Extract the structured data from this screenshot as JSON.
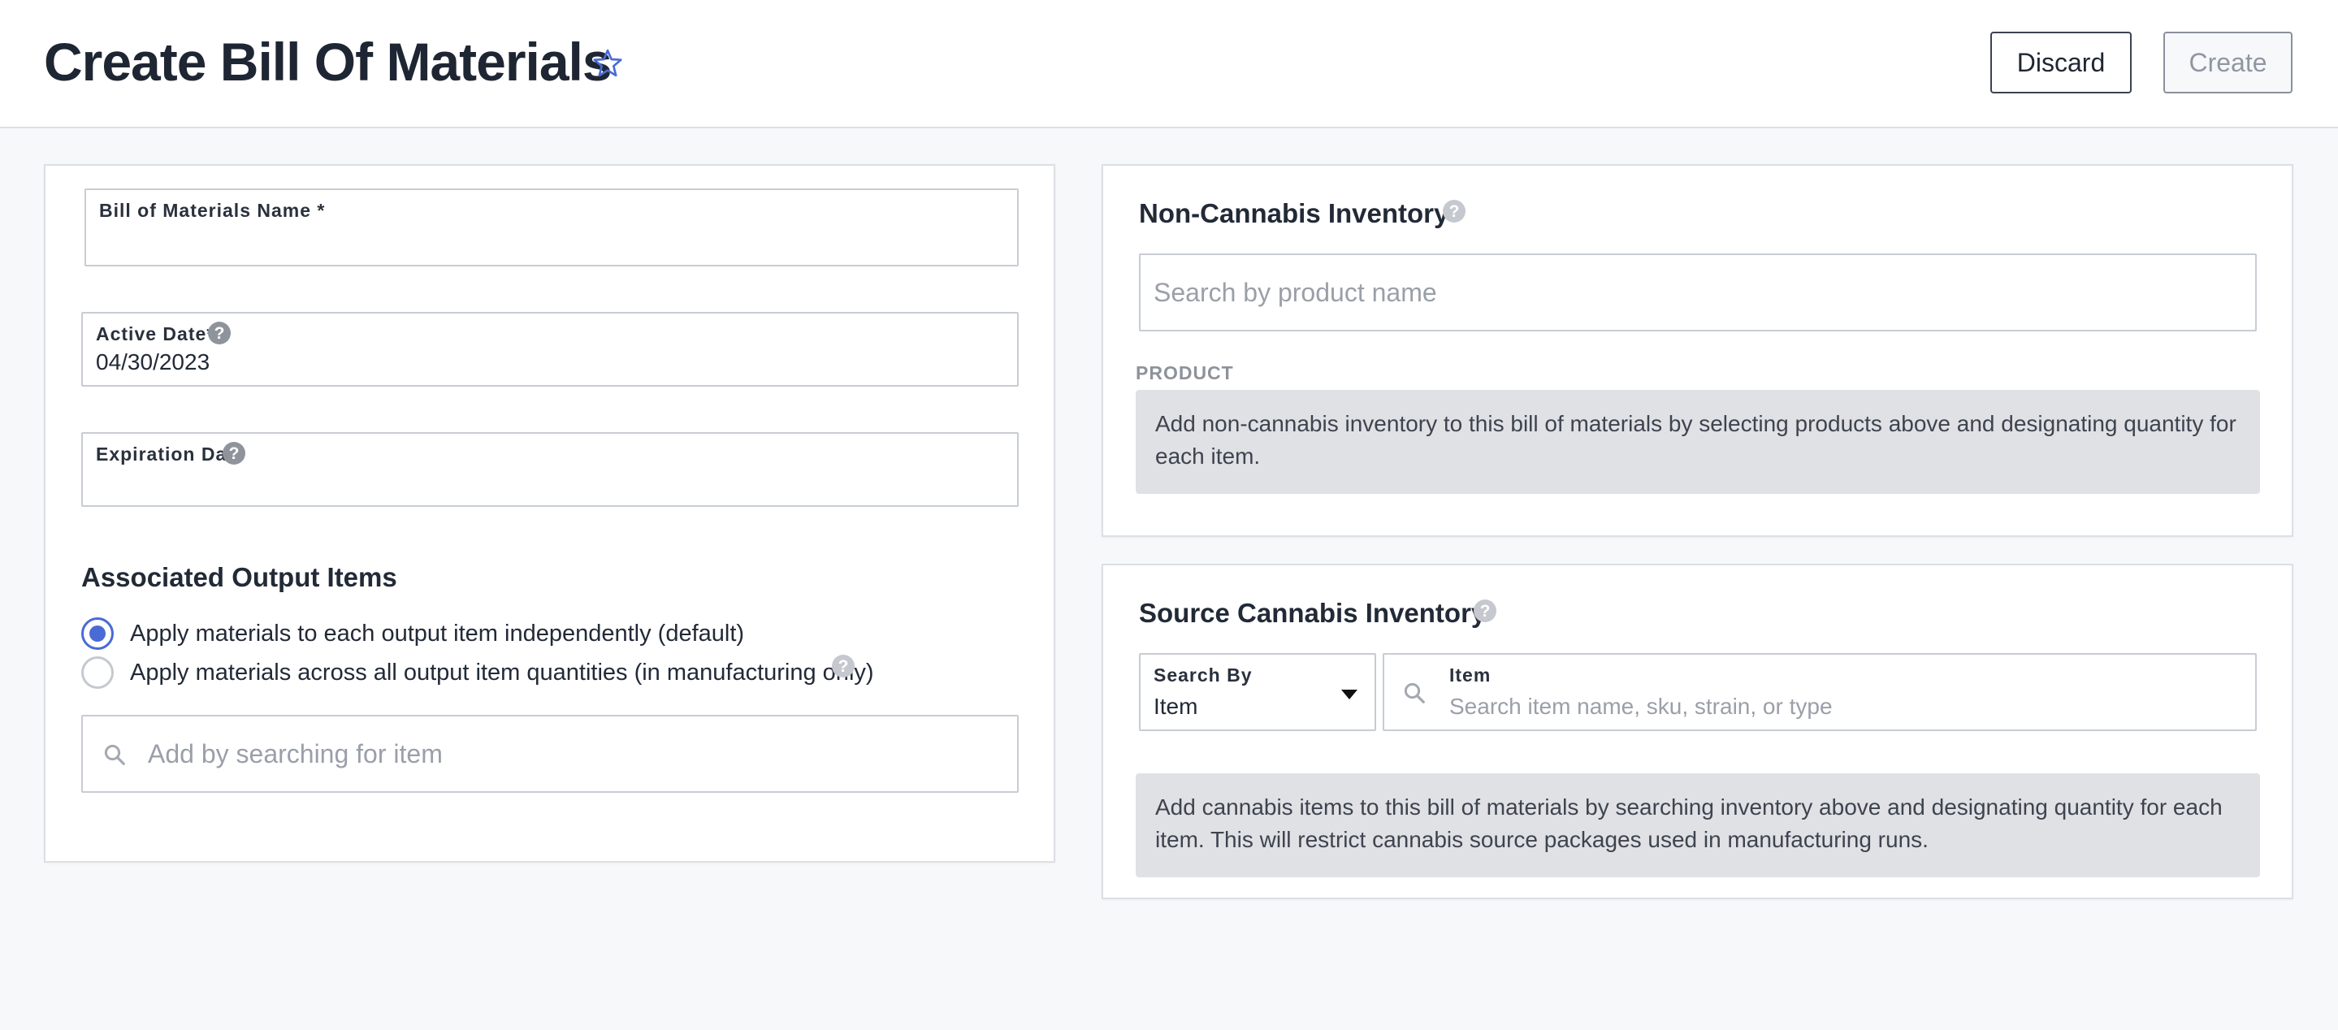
{
  "header": {
    "title": "Create Bill Of Materials",
    "discard_label": "Discard",
    "create_label": "Create"
  },
  "form": {
    "bom_name": {
      "label": "Bill of Materials Name *",
      "value": ""
    },
    "active_date": {
      "label": "Active Date*",
      "value": "04/30/2023",
      "help": "?"
    },
    "expiration_date": {
      "label": "Expiration Date",
      "value": "",
      "help": "?"
    }
  },
  "output_items": {
    "title": "Associated Output Items",
    "options": [
      {
        "label": "Apply materials to each output item independently (default)",
        "selected": true
      },
      {
        "label": "Apply materials across all output item quantities (in manufacturing only)",
        "selected": false
      }
    ],
    "help": "?",
    "search_placeholder": "Add by searching for item"
  },
  "non_cannabis": {
    "title": "Non-Cannabis Inventory",
    "help": "?",
    "search_placeholder": "Search by product name",
    "column_header": "PRODUCT",
    "empty_message": "Add non-cannabis inventory to this bill of materials by selecting products above and designating quantity for each item."
  },
  "source_cannabis": {
    "title": "Source Cannabis Inventory",
    "help": "?",
    "search_by": {
      "label": "Search By",
      "value": "Item"
    },
    "item_field": {
      "label": "Item",
      "placeholder": "Search item name, sku, strain, or type"
    },
    "empty_message": "Add cannabis items to this bill of materials by searching inventory above and designating quantity for each item. This will restrict cannabis source packages used in manufacturing runs."
  },
  "colors": {
    "accent": "#4a6bd6",
    "title_text": "#1f2633",
    "info_background": "#e0e1e4"
  },
  "icons": [
    "star-icon",
    "help-icon",
    "search-icon",
    "caret-down-icon"
  ]
}
